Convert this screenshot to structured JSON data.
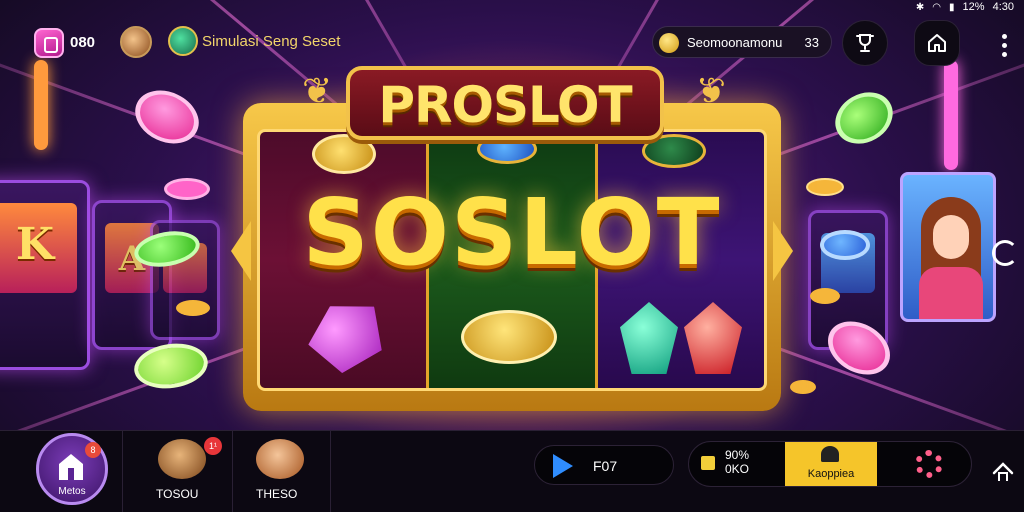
{
  "status_bar": {
    "time": "4:30",
    "battery": "12%"
  },
  "header": {
    "coin_count": "080",
    "game_name": "Simulasi Seng Seset",
    "balance_label": "Seomoonamonu",
    "balance_value": "33"
  },
  "logo": {
    "text": "PROSLOT"
  },
  "main_title": "SOSLOT",
  "bottom_bar": {
    "home_label": "Metos",
    "home_badge": "8",
    "pet1_label": "TOSOU",
    "pet1_badge": "1¹",
    "pet2_label": "THESO",
    "play_label": "F07",
    "bet_percent": "90%",
    "bet_sub": "0KO",
    "action_label": "Kaoppiea"
  },
  "colors": {
    "accent_gold": "#f5c52a",
    "play_blue": "#2f8dff",
    "gear_pink": "#ff5f8a",
    "reel_red": "#6c1035",
    "reel_green": "#1c5a1c",
    "reel_purple": "#3d1475"
  },
  "icons": {
    "gem_badge": "gem-icon",
    "trophy": "trophy-icon",
    "home": "home-icon",
    "more": "more-vertical-icon",
    "play": "play-icon",
    "settings": "gear-icon",
    "reload": "reload-icon",
    "collapse": "chevron-up-icon"
  }
}
